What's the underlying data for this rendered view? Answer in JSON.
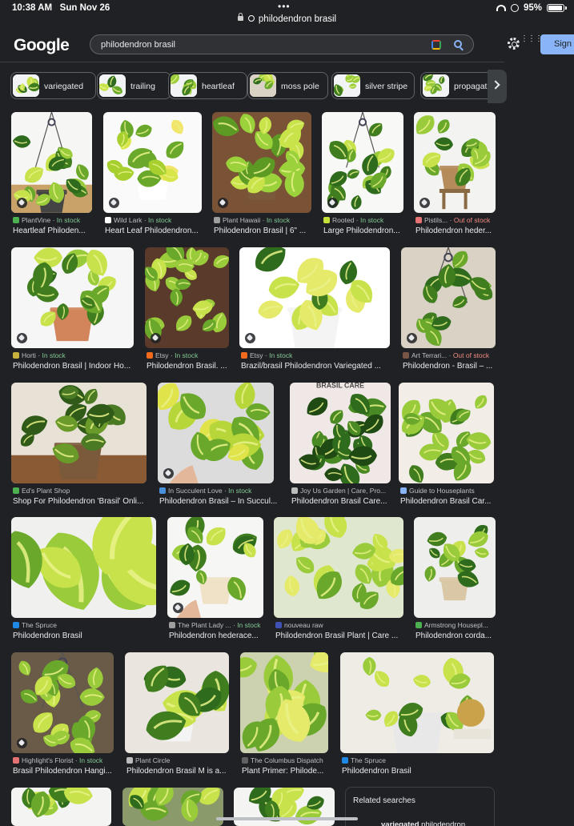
{
  "status_bar": {
    "time": "10:38 AM",
    "date": "Sun Nov 26",
    "dots": "•••",
    "url": "philodendron brasil",
    "battery": "95%",
    "battery_level": 0.95
  },
  "header": {
    "logo": "Google",
    "query": "philodendron brasil",
    "signin_label": "Sign"
  },
  "chips": [
    {
      "label": "variegated"
    },
    {
      "label": "trailing"
    },
    {
      "label": "heartleaf"
    },
    {
      "label": "moss pole"
    },
    {
      "label": "silver stripe"
    },
    {
      "label": "propagat"
    }
  ],
  "results": [
    {
      "source": "PlantVine",
      "stock": "In stock",
      "caption": "Heartleaf Philoden..."
    },
    {
      "source": "Wild Lark",
      "stock": "In stock",
      "caption": "Heart Leaf Philodendron..."
    },
    {
      "source": "Plant Hawaii",
      "stock": "In stock",
      "caption": "Philodendron Brasil | 6\" ..."
    },
    {
      "source": "Rooted",
      "stock": "In stock",
      "caption": "Large Philodendron..."
    },
    {
      "source": "Pistils...",
      "stock": "Out of stock",
      "caption": "Philodendron heder..."
    },
    {
      "source": "Horti",
      "stock": "In stock",
      "caption": "Philodendron Brasil | Indoor Ho..."
    },
    {
      "source": "Etsy",
      "stock": "In stock",
      "caption": "Philodendron Brasil. ..."
    },
    {
      "source": "Etsy",
      "stock": "In stock",
      "caption": "Brazil/brasil Philodendron Variegated ..."
    },
    {
      "source": "Art Terrari...",
      "stock": "Out of stock",
      "caption": "Philodendron - Brasil – ..."
    },
    {
      "source": "Ed's Plant Shop",
      "stock": "",
      "caption": "Shop For Philodendron 'Brasil' Onli..."
    },
    {
      "source": "In Succulent Love",
      "stock": "In stock",
      "caption": "Philodendron Brasil – In Succul..."
    },
    {
      "source": "Joy Us Garden | Care, Pro...",
      "stock": "",
      "caption": "Philodendron Brasil Care..."
    },
    {
      "source": "Guide to Houseplants",
      "stock": "",
      "caption": "Philodendron Brasil Car..."
    },
    {
      "source": "The Spruce",
      "stock": "",
      "caption": "Philodendron Brasil"
    },
    {
      "source": "The Plant Lady ...",
      "stock": "In stock",
      "caption": "Philodendron hederace..."
    },
    {
      "source": "nouveau raw",
      "stock": "",
      "caption": "Philodendron Brasil Plant | Care ..."
    },
    {
      "source": "Armstrong Housepl...",
      "stock": "",
      "caption": "Philodendron corda..."
    },
    {
      "source": "Highlight's Florist",
      "stock": "In stock",
      "caption": "Brasil Philodendron Hangi..."
    },
    {
      "source": "Plant Circle",
      "stock": "",
      "caption": "Philodendron Brasil M is a..."
    },
    {
      "source": "The Columbus Dispatch",
      "stock": "",
      "caption": "Plant Primer: Philode..."
    },
    {
      "source": "The Spruce",
      "stock": "",
      "caption": "Philodendron Brasil"
    }
  ],
  "overlay_text": {
    "brasil_care": "BRASIL CARE"
  },
  "related": {
    "title": "Related searches",
    "first_bold": "variegated",
    "first_rest": " philodendron"
  },
  "colors": {
    "background": "#202124",
    "in_stock": "#81c995",
    "out_of_stock": "#f28b82",
    "signin": "#8ab4f8"
  }
}
